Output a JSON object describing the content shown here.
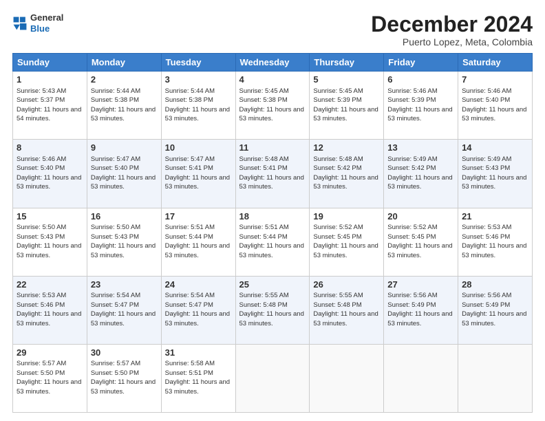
{
  "header": {
    "logo": {
      "general": "General",
      "blue": "Blue"
    },
    "title": "December 2024",
    "location": "Puerto Lopez, Meta, Colombia"
  },
  "calendar": {
    "days_of_week": [
      "Sunday",
      "Monday",
      "Tuesday",
      "Wednesday",
      "Thursday",
      "Friday",
      "Saturday"
    ],
    "weeks": [
      [
        {
          "day": "1",
          "sunrise": "5:43 AM",
          "sunset": "5:37 PM",
          "daylight": "11 hours and 54 minutes."
        },
        {
          "day": "2",
          "sunrise": "5:44 AM",
          "sunset": "5:38 PM",
          "daylight": "11 hours and 53 minutes."
        },
        {
          "day": "3",
          "sunrise": "5:44 AM",
          "sunset": "5:38 PM",
          "daylight": "11 hours and 53 minutes."
        },
        {
          "day": "4",
          "sunrise": "5:45 AM",
          "sunset": "5:38 PM",
          "daylight": "11 hours and 53 minutes."
        },
        {
          "day": "5",
          "sunrise": "5:45 AM",
          "sunset": "5:39 PM",
          "daylight": "11 hours and 53 minutes."
        },
        {
          "day": "6",
          "sunrise": "5:46 AM",
          "sunset": "5:39 PM",
          "daylight": "11 hours and 53 minutes."
        },
        {
          "day": "7",
          "sunrise": "5:46 AM",
          "sunset": "5:40 PM",
          "daylight": "11 hours and 53 minutes."
        }
      ],
      [
        {
          "day": "8",
          "sunrise": "5:46 AM",
          "sunset": "5:40 PM",
          "daylight": "11 hours and 53 minutes."
        },
        {
          "day": "9",
          "sunrise": "5:47 AM",
          "sunset": "5:40 PM",
          "daylight": "11 hours and 53 minutes."
        },
        {
          "day": "10",
          "sunrise": "5:47 AM",
          "sunset": "5:41 PM",
          "daylight": "11 hours and 53 minutes."
        },
        {
          "day": "11",
          "sunrise": "5:48 AM",
          "sunset": "5:41 PM",
          "daylight": "11 hours and 53 minutes."
        },
        {
          "day": "12",
          "sunrise": "5:48 AM",
          "sunset": "5:42 PM",
          "daylight": "11 hours and 53 minutes."
        },
        {
          "day": "13",
          "sunrise": "5:49 AM",
          "sunset": "5:42 PM",
          "daylight": "11 hours and 53 minutes."
        },
        {
          "day": "14",
          "sunrise": "5:49 AM",
          "sunset": "5:43 PM",
          "daylight": "11 hours and 53 minutes."
        }
      ],
      [
        {
          "day": "15",
          "sunrise": "5:50 AM",
          "sunset": "5:43 PM",
          "daylight": "11 hours and 53 minutes."
        },
        {
          "day": "16",
          "sunrise": "5:50 AM",
          "sunset": "5:43 PM",
          "daylight": "11 hours and 53 minutes."
        },
        {
          "day": "17",
          "sunrise": "5:51 AM",
          "sunset": "5:44 PM",
          "daylight": "11 hours and 53 minutes."
        },
        {
          "day": "18",
          "sunrise": "5:51 AM",
          "sunset": "5:44 PM",
          "daylight": "11 hours and 53 minutes."
        },
        {
          "day": "19",
          "sunrise": "5:52 AM",
          "sunset": "5:45 PM",
          "daylight": "11 hours and 53 minutes."
        },
        {
          "day": "20",
          "sunrise": "5:52 AM",
          "sunset": "5:45 PM",
          "daylight": "11 hours and 53 minutes."
        },
        {
          "day": "21",
          "sunrise": "5:53 AM",
          "sunset": "5:46 PM",
          "daylight": "11 hours and 53 minutes."
        }
      ],
      [
        {
          "day": "22",
          "sunrise": "5:53 AM",
          "sunset": "5:46 PM",
          "daylight": "11 hours and 53 minutes."
        },
        {
          "day": "23",
          "sunrise": "5:54 AM",
          "sunset": "5:47 PM",
          "daylight": "11 hours and 53 minutes."
        },
        {
          "day": "24",
          "sunrise": "5:54 AM",
          "sunset": "5:47 PM",
          "daylight": "11 hours and 53 minutes."
        },
        {
          "day": "25",
          "sunrise": "5:55 AM",
          "sunset": "5:48 PM",
          "daylight": "11 hours and 53 minutes."
        },
        {
          "day": "26",
          "sunrise": "5:55 AM",
          "sunset": "5:48 PM",
          "daylight": "11 hours and 53 minutes."
        },
        {
          "day": "27",
          "sunrise": "5:56 AM",
          "sunset": "5:49 PM",
          "daylight": "11 hours and 53 minutes."
        },
        {
          "day": "28",
          "sunrise": "5:56 AM",
          "sunset": "5:49 PM",
          "daylight": "11 hours and 53 minutes."
        }
      ],
      [
        {
          "day": "29",
          "sunrise": "5:57 AM",
          "sunset": "5:50 PM",
          "daylight": "11 hours and 53 minutes."
        },
        {
          "day": "30",
          "sunrise": "5:57 AM",
          "sunset": "5:50 PM",
          "daylight": "11 hours and 53 minutes."
        },
        {
          "day": "31",
          "sunrise": "5:58 AM",
          "sunset": "5:51 PM",
          "daylight": "11 hours and 53 minutes."
        },
        null,
        null,
        null,
        null
      ]
    ]
  }
}
